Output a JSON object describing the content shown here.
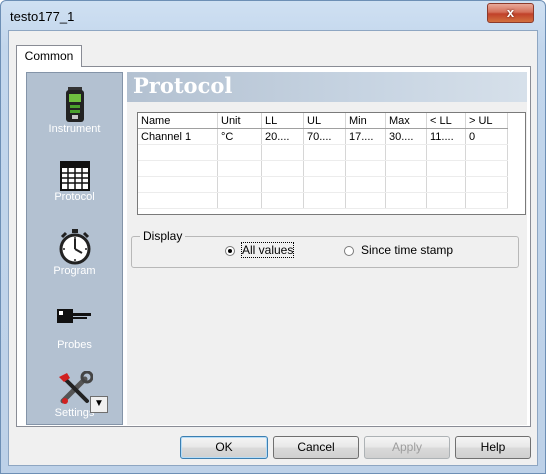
{
  "window": {
    "title": "testo177_1",
    "close_glyph": "x"
  },
  "tabs": [
    {
      "label": "Common"
    }
  ],
  "sidebar": {
    "items": [
      {
        "label": "Instrument",
        "icon": "instrument-icon"
      },
      {
        "label": "Protocol",
        "icon": "protocol-grid-icon"
      },
      {
        "label": "Program",
        "icon": "stopwatch-icon"
      },
      {
        "label": "Probes",
        "icon": "probe-icon"
      },
      {
        "label": "Settings",
        "icon": "tools-icon"
      }
    ],
    "scroll_glyph": "▼"
  },
  "main": {
    "heading": "Protocol",
    "table": {
      "columns": [
        "Name",
        "Unit",
        "LL",
        "UL",
        "Min",
        "Max",
        "< LL",
        "> UL"
      ],
      "rows": [
        [
          "Channel 1",
          "°C",
          "20....",
          "70....",
          "17....",
          "30....",
          "11....",
          "0"
        ]
      ]
    },
    "display": {
      "group_label": "Display",
      "options": [
        {
          "label": "All values",
          "selected": true
        },
        {
          "label": "Since time stamp",
          "selected": false
        }
      ]
    }
  },
  "buttons": {
    "ok": "OK",
    "cancel": "Cancel",
    "apply": "Apply",
    "help": "Help"
  },
  "colors": {
    "sidebar_bg": "#b3c1d1",
    "heading_text": "#ffffff",
    "close_button": "#c1412a"
  }
}
